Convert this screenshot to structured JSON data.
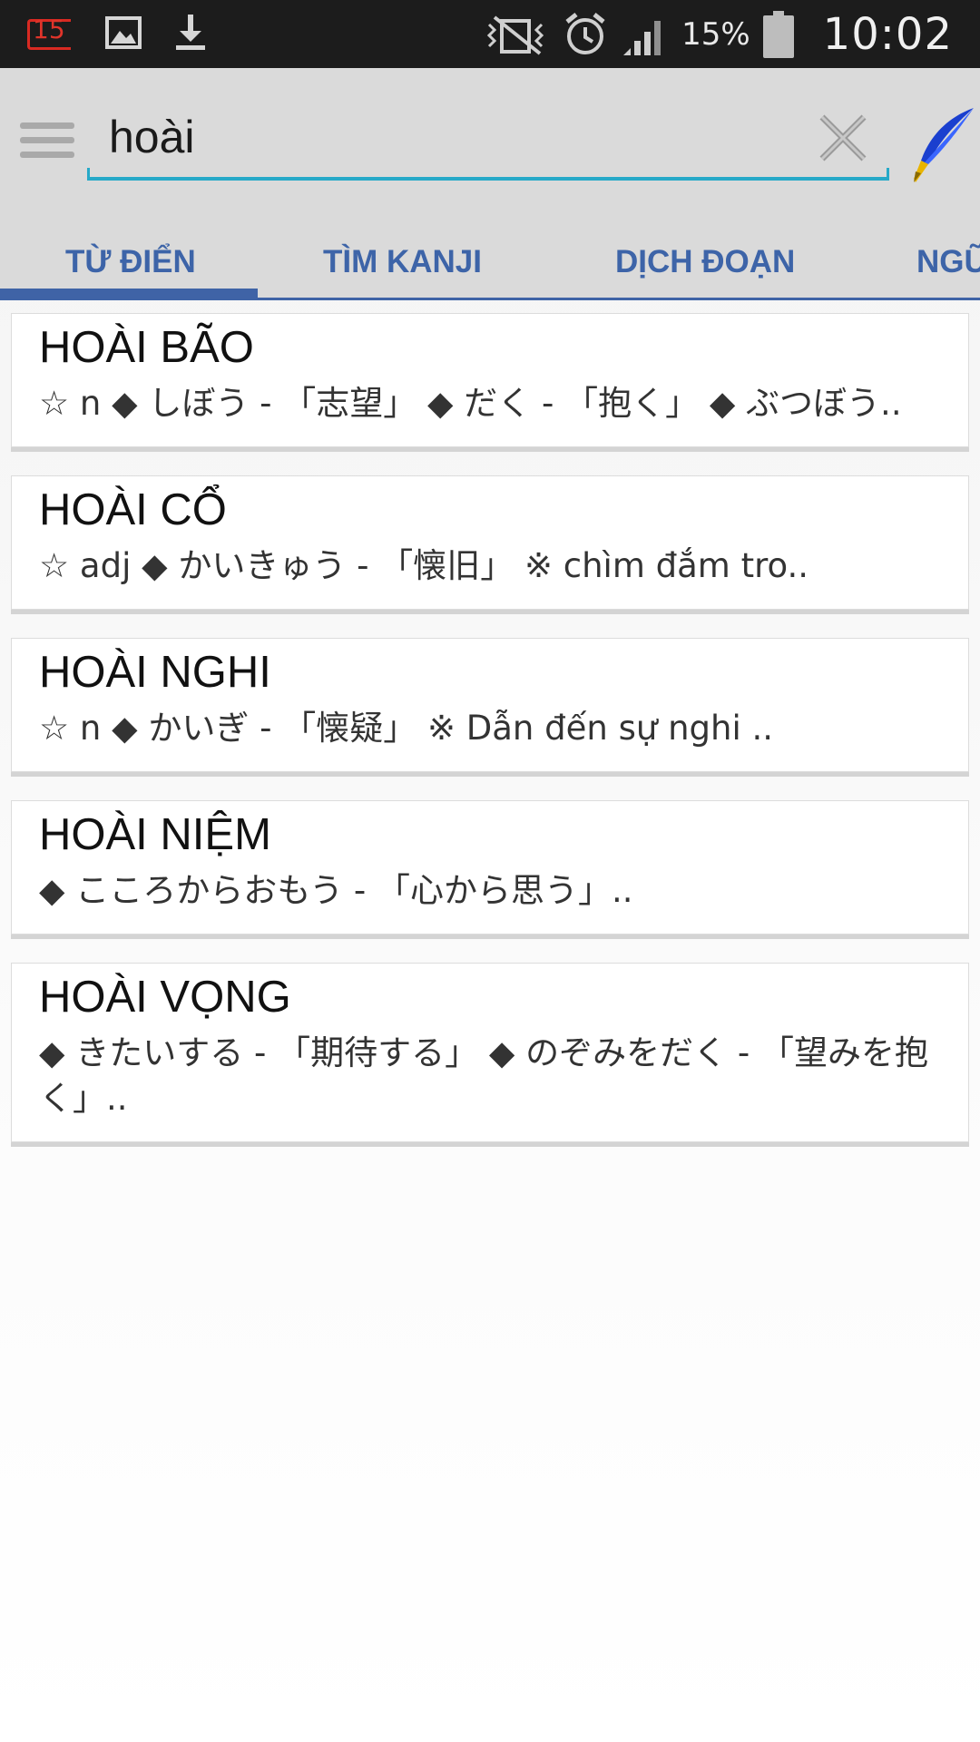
{
  "status_bar": {
    "notification_count": "15",
    "battery_percent": "15%",
    "time": "10:02"
  },
  "search": {
    "query": "hoài",
    "placeholder": ""
  },
  "tabs": [
    {
      "label": "TỪ ĐIỂN",
      "selected": true
    },
    {
      "label": "TÌM KANJI",
      "selected": false
    },
    {
      "label": "DỊCH ĐOẠN",
      "selected": false
    },
    {
      "label": "NGỮ",
      "selected": false
    }
  ],
  "results": [
    {
      "title": "HOÀI BÃO",
      "description": "☆ n ◆ しぼう - 「志望」 ◆ だく - 「抱く」 ◆ ぶつぼう.."
    },
    {
      "title": "HOÀI CỔ",
      "description": "☆ adj ◆ かいきゅう - 「懐旧」 ※ chìm đắm tro.."
    },
    {
      "title": "HOÀI NGHI",
      "description": "☆ n ◆ かいぎ - 「懐疑」 ※ Dẫn đến sự nghi .."
    },
    {
      "title": "HOÀI NIỆM",
      "description": "◆ こころからおもう - 「心から思う」.."
    },
    {
      "title": "HOÀI VỌNG",
      "description": "◆ きたいする - 「期待する」 ◆ のぞみをだく - 「望みを抱く」.."
    }
  ],
  "colors": {
    "accent": "#3f63a6",
    "search_underline": "#26a9c8",
    "status_bar": "#1c1c1c",
    "toolbar": "#dadada"
  },
  "icons": {
    "menu": "hamburger-menu-icon",
    "clear": "close-icon",
    "handwriting": "quill-pen-icon"
  }
}
